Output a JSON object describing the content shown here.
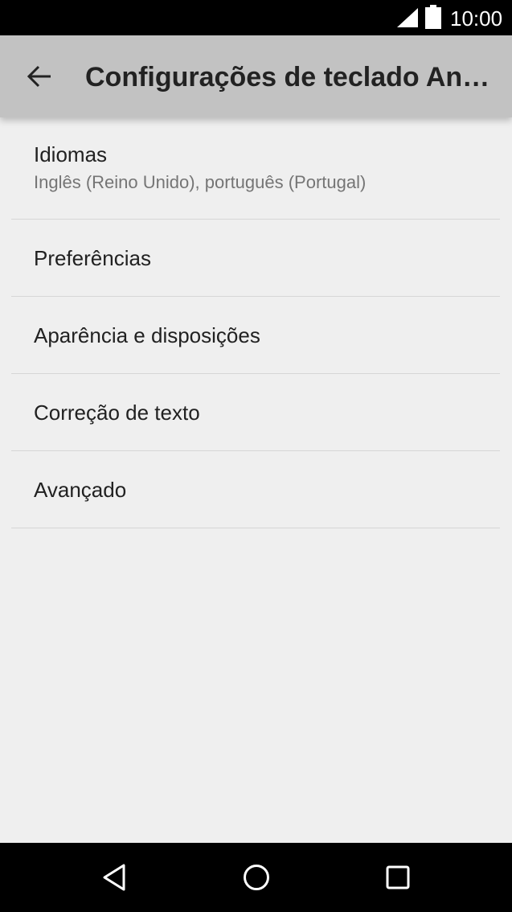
{
  "status_bar": {
    "time": "10:00",
    "signal_icon": "cell-signal-icon",
    "battery_icon": "battery-icon"
  },
  "app_bar": {
    "back_icon": "arrow-back-icon",
    "title": "Configurações de teclado Android (AOSP)"
  },
  "settings": {
    "items": [
      {
        "label": "Idiomas",
        "summary": "Inglês (Reino Unido), português (Portugal)"
      },
      {
        "label": "Preferências"
      },
      {
        "label": "Aparência e disposições"
      },
      {
        "label": "Correção de texto"
      },
      {
        "label": "Avançado"
      }
    ]
  },
  "nav_bar": {
    "back_icon": "nav-back-triangle-icon",
    "home_icon": "nav-home-circle-icon",
    "recents_icon": "nav-recents-square-icon"
  },
  "colors": {
    "status_bar": "#000000",
    "app_bar": "#c2c2c2",
    "background": "#efefef",
    "divider": "#d6d6d6",
    "primary_text": "#212121",
    "secondary_text": "#757575"
  }
}
